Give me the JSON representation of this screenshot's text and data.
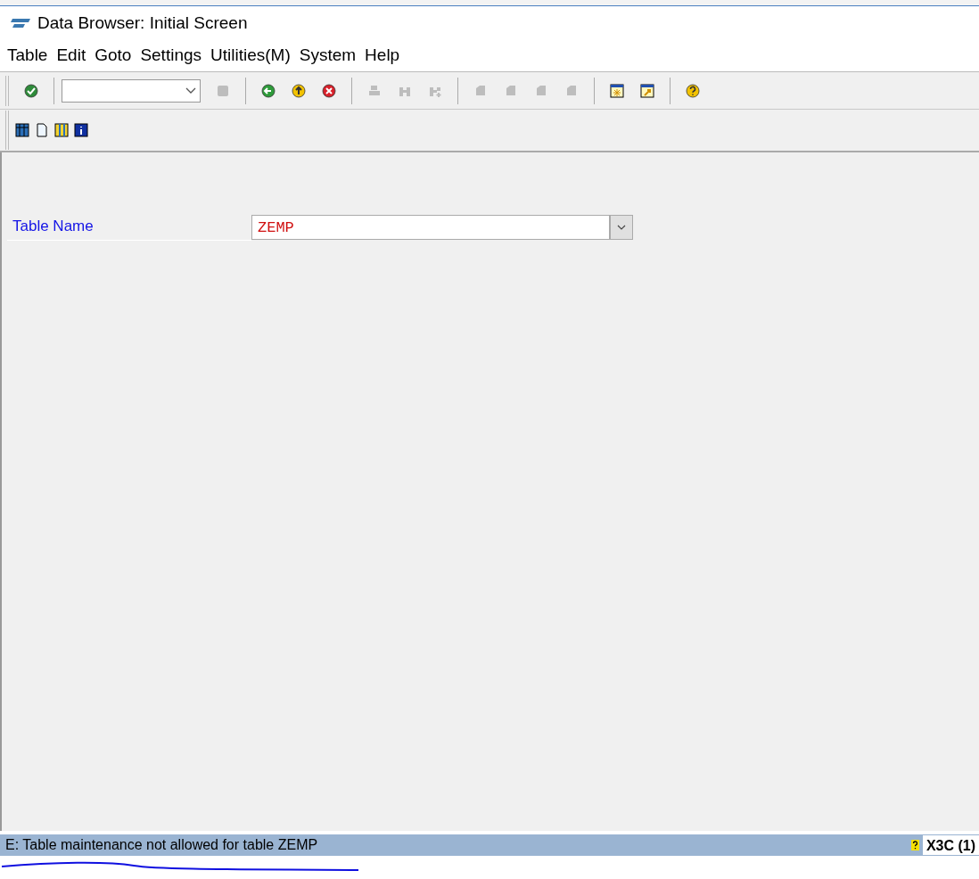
{
  "window": {
    "title": "Data Browser: Initial Screen"
  },
  "menu": [
    "Table",
    "Edit",
    "Goto",
    "Settings",
    "Utilities(M)",
    "System",
    "Help"
  ],
  "toolbar": [
    {
      "kind": "button",
      "disabled": false
    },
    {
      "kind": "separator"
    },
    {
      "kind": "command-field"
    },
    {
      "kind": "button",
      "disabled": true
    },
    {
      "kind": "separator"
    },
    {
      "kind": "button",
      "disabled": false
    },
    {
      "kind": "button",
      "disabled": false
    },
    {
      "kind": "button",
      "disabled": false
    },
    {
      "kind": "separator"
    },
    {
      "kind": "button",
      "disabled": true
    },
    {
      "kind": "button",
      "disabled": true
    },
    {
      "kind": "button",
      "disabled": true
    },
    {
      "kind": "separator"
    },
    {
      "kind": "button",
      "disabled": true
    },
    {
      "kind": "button",
      "disabled": true
    },
    {
      "kind": "button",
      "disabled": true
    },
    {
      "kind": "button",
      "disabled": true
    },
    {
      "kind": "separator"
    },
    {
      "kind": "button",
      "disabled": false
    },
    {
      "kind": "button",
      "disabled": false
    },
    {
      "kind": "separator"
    },
    {
      "kind": "button",
      "disabled": false
    }
  ],
  "app_toolbar": [
    {
      "kind": "button"
    },
    {
      "kind": "button"
    },
    {
      "kind": "button"
    },
    {
      "kind": "button"
    }
  ],
  "form": {
    "label": "Table Name",
    "value": "ZEMP"
  },
  "status_bar": {
    "message": "E: Table maintenance not allowed for table ZEMP",
    "system": "X3C (1)"
  }
}
